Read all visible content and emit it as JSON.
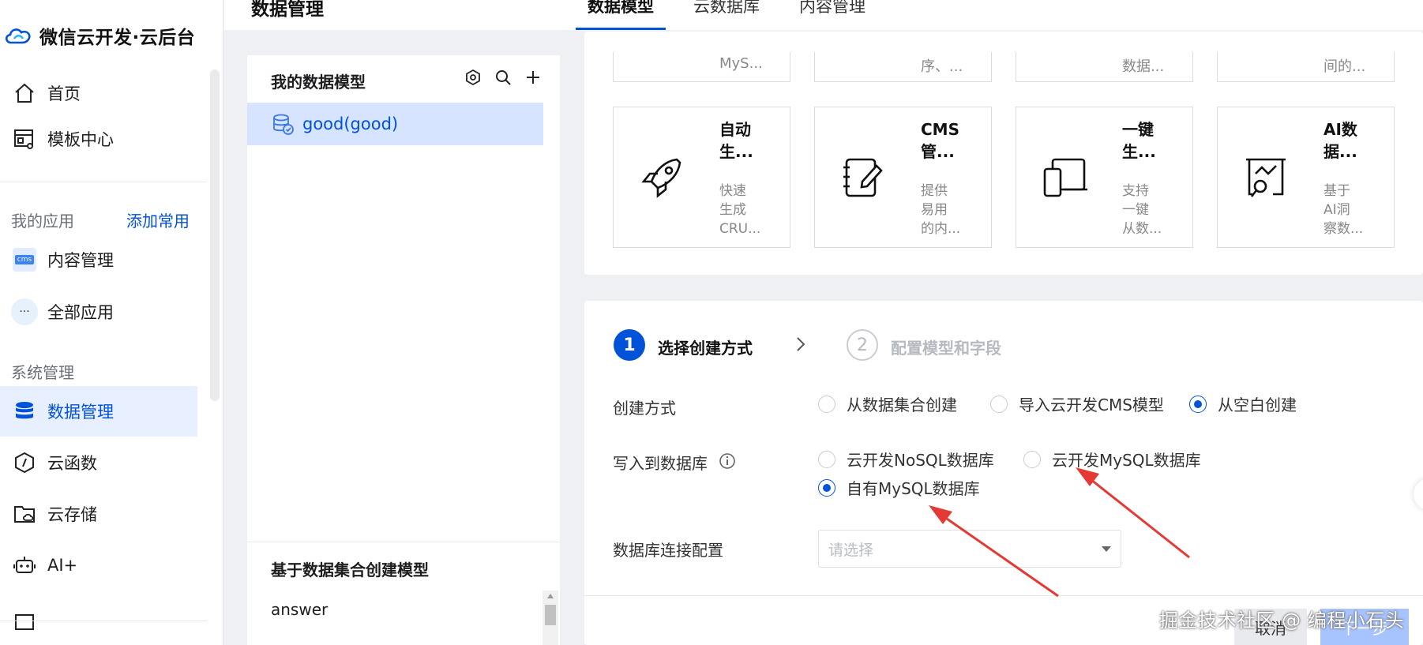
{
  "brand": {
    "title": "微信云开发·云后台"
  },
  "nav": {
    "home": "首页",
    "templates": "模板中心",
    "my_apps_section": "我的应用",
    "add_favorite": "添加常用",
    "content_mgmt": "内容管理",
    "all_apps": "全部应用",
    "system_section": "系统管理",
    "data_mgmt": "数据管理",
    "cloud_functions": "云函数",
    "cloud_storage": "云存储",
    "ai_plus": "AI+",
    "cms_badge": "cms",
    "all_apps_badge": "···"
  },
  "header": {
    "title": "数据管理",
    "tabs": [
      "数据模型",
      "云数据库",
      "内容管理"
    ],
    "active_tab": "数据模型"
  },
  "model_panel": {
    "title": "我的数据模型",
    "models": [
      "good(good)"
    ],
    "collection_section_title": "基于数据集合创建模型",
    "collections": [
      "answer"
    ]
  },
  "template_cards": {
    "partial_row": [
      "MyS...",
      "序、...",
      "数据...",
      "间的..."
    ],
    "cards": [
      {
        "title": "自动\n生...",
        "desc": "快速\n生成\nCRU...",
        "icon": "rocket-icon"
      },
      {
        "title": "CMS\n管...",
        "desc": "提供\n易用\n的内...",
        "icon": "notebook-pen-icon"
      },
      {
        "title": "一键\n生...",
        "desc": "支持\n一键\n从数...",
        "icon": "devices-icon"
      },
      {
        "title": "AI数\n据...",
        "desc": "基于\nAI洞\n察数...",
        "icon": "chart-search-icon"
      }
    ]
  },
  "form": {
    "steps": [
      {
        "num": "1",
        "label": "选择创建方式",
        "state": "active"
      },
      {
        "num": "2",
        "label": "配置模型和字段",
        "state": "inactive"
      }
    ],
    "create_method": {
      "label": "创建方式",
      "options": [
        "从数据集合创建",
        "导入云开发CMS模型",
        "从空白创建"
      ],
      "selected": "从空白创建"
    },
    "write_db": {
      "label": "写入到数据库",
      "options": [
        "云开发NoSQL数据库",
        "云开发MySQL数据库",
        "自有MySQL数据库"
      ],
      "selected": "自有MySQL数据库"
    },
    "db_connection": {
      "label": "数据库连接配置",
      "placeholder": "请选择"
    },
    "buttons": {
      "cancel": "取消",
      "next": "下一步"
    }
  },
  "watermark": "掘金技术社区 @ 编程小石头",
  "colors": {
    "accent": "#0052d9",
    "annotation_arrow": "#e53935",
    "active_bg": "#e8f0ff"
  }
}
